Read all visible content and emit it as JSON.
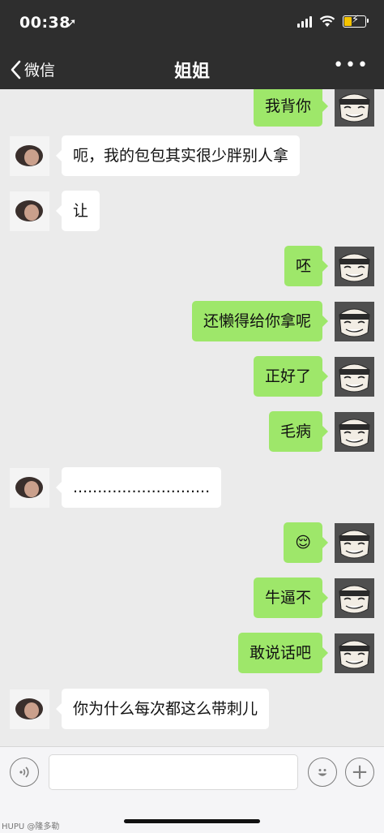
{
  "status_bar": {
    "time": "00:38",
    "location_icon": "location-arrow-icon",
    "signal_icon": "signal-bars-icon",
    "wifi_icon": "wifi-icon",
    "battery_icon": "battery-charging-icon",
    "battery_color": "#f5c400"
  },
  "nav": {
    "back_label": "微信",
    "title": "姐姐",
    "more_label": "•••"
  },
  "messages": [
    {
      "side": "right",
      "text": "我背你"
    },
    {
      "side": "left",
      "text": "呃，我的包包其实很少胖别人拿"
    },
    {
      "side": "left",
      "text": "让"
    },
    {
      "side": "right",
      "text": "呸"
    },
    {
      "side": "right",
      "text": "还懒得给你拿呢"
    },
    {
      "side": "right",
      "text": "正好了"
    },
    {
      "side": "right",
      "text": "毛病"
    },
    {
      "side": "left",
      "text": "............................"
    },
    {
      "side": "right",
      "text": "😌"
    },
    {
      "side": "right",
      "text": "牛逼不"
    },
    {
      "side": "right",
      "text": "敢说话吧"
    },
    {
      "side": "left",
      "text": "你为什么每次都这么带刺儿"
    }
  ],
  "input_bar": {
    "voice_icon": "voice-icon",
    "emoji_icon": "emoji-icon",
    "plus_label": "+"
  },
  "watermark": "HUPU @隆多勒",
  "colors": {
    "header_bg": "#2e2e2e",
    "chat_bg": "#ebebeb",
    "sent_bubble": "#9ee76a",
    "received_bubble": "#ffffff"
  }
}
